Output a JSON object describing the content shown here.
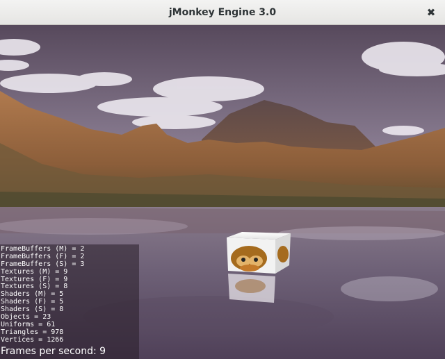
{
  "window": {
    "title": "jMonkey Engine 3.0",
    "close_icon": "close-icon",
    "close_glyph": "✖"
  },
  "scene": {
    "description_icon": "3d-scene-viewport",
    "colors": {
      "sky_top": "#5f5466",
      "sky_mid": "#8d8296",
      "mountain": "#9a6a45",
      "water": "#6e6278",
      "cube_face": "#f0f0f0"
    }
  },
  "stats": {
    "lines": [
      "FrameBuffers (M) = 2",
      "FrameBuffers (F) = 2",
      "FrameBuffers (S) = 3",
      "Textures (M) = 9",
      "Textures (F) = 9",
      "Textures (S) = 8",
      "Shaders (M) = 5",
      "Shaders (F) = 5",
      "Shaders (S) = 8",
      "Objects = 23",
      "Uniforms = 61",
      "Triangles = 978",
      "Vertices = 1266"
    ],
    "fps_label": "Frames per second: 9"
  }
}
